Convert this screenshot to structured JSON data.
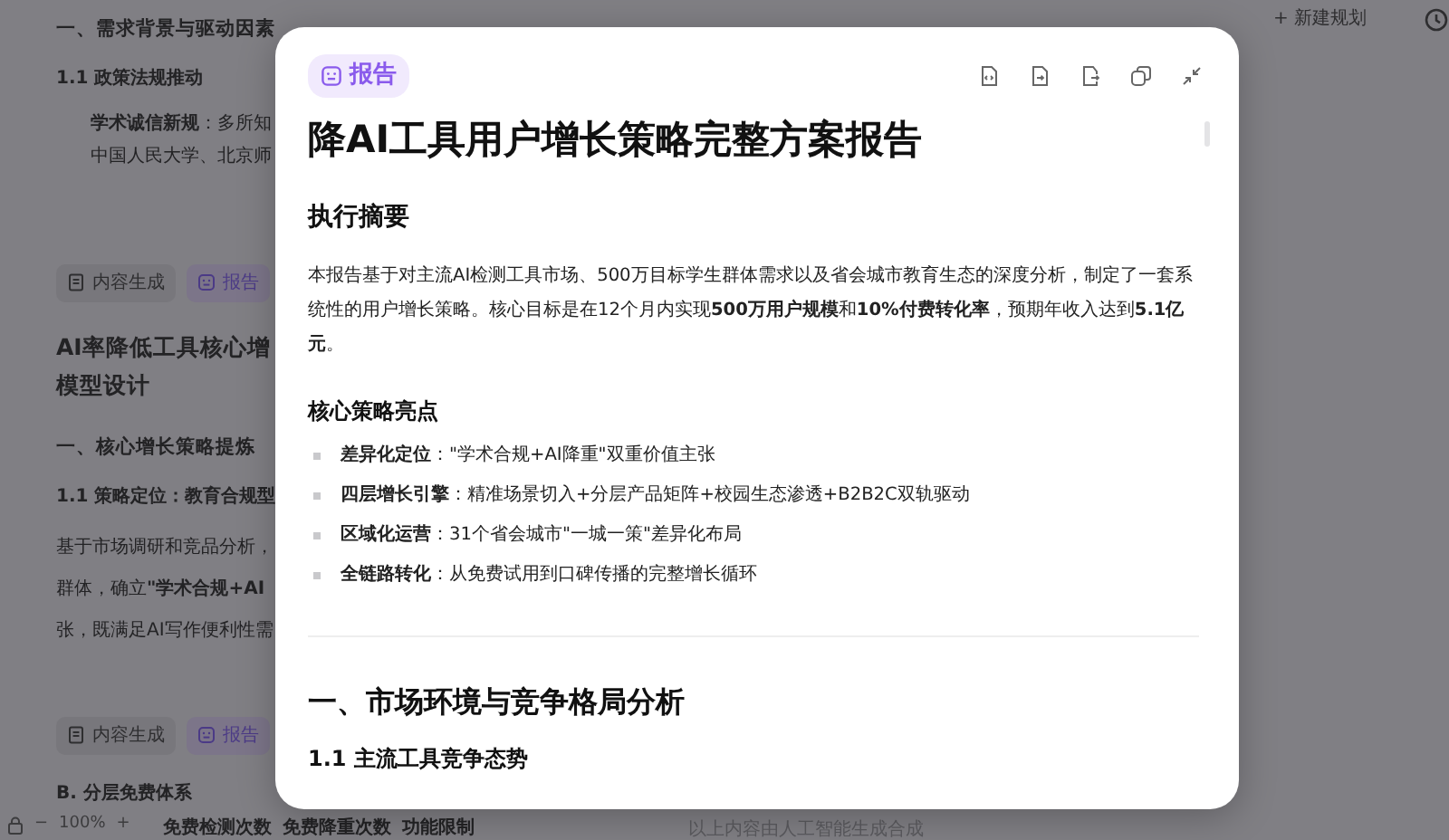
{
  "background_document": {
    "blocks": [
      {
        "kind": "heading",
        "text": "一、需求背景与驱动因素"
      },
      {
        "kind": "subheading",
        "text": "1.1 政策法规推动"
      },
      {
        "kind": "bullet",
        "lines": [
          "**学术诚信新规**：多所知",
          "中国人民大学、北京师"
        ]
      },
      {
        "kind": "tags",
        "tags": [
          {
            "label": "内容生成",
            "selected": false
          },
          {
            "label": "报告",
            "selected": true
          }
        ]
      },
      {
        "kind": "title",
        "lines": [
          "AI率降低工具核心增",
          "模型设计"
        ]
      },
      {
        "kind": "heading",
        "text": "一、核心增长策略提炼"
      },
      {
        "kind": "subheading",
        "text": "1.1 策略定位：教育合规型"
      },
      {
        "kind": "paragraph",
        "lines": [
          "基于市场调研和竞品分析，",
          "群体，确立**\"学术合规+AI**",
          "张，既满足AI写作便利性需"
        ]
      },
      {
        "kind": "tags",
        "tags": [
          {
            "label": "内容生成",
            "selected": false
          },
          {
            "label": "报告",
            "selected": true
          }
        ]
      },
      {
        "kind": "subheading",
        "text": "B. 分层免费体系"
      },
      {
        "kind": "table_header",
        "columns": [
          "免费检测次数",
          "免费降重次数",
          "功能限制"
        ]
      }
    ]
  },
  "zoom_control": {
    "value": "100%",
    "minus": "−",
    "plus": "+"
  },
  "toolbar": {
    "new_plan": "+ 新建规划"
  },
  "footer_note": "以上内容由人工智能生成合成",
  "report_modal": {
    "badge": "报告",
    "title": "降AI工具用户增长策略完整方案报告",
    "sections": [
      {
        "kind": "h2",
        "text": "执行摘要"
      },
      {
        "kind": "paragraph",
        "text": "本报告基于对主流AI检测工具市场、500万目标学生群体需求以及省会城市教育生态的深度分析，制定了一套系统性的用户增长策略。核心目标是在12个月内实现**500万用户规模**和**10%付费转化率**，预期年收入达到**5.1亿元**。"
      },
      {
        "kind": "h3",
        "text": "核心策略亮点"
      },
      {
        "kind": "bullets",
        "items": [
          "**差异化定位**：\"学术合规+AI降重\"双重价值主张",
          "**四层增长引擎**：精准场景切入+分层产品矩阵+校园生态渗透+B2B2C双轨驱动",
          "**区域化运营**：31个省会城市\"一城一策\"差异化布局",
          "**全链路转化**：从免费试用到口碑传播的完整增长循环"
        ]
      },
      {
        "kind": "divider"
      },
      {
        "kind": "h2",
        "text": "一、市场环境与竞争格局分析"
      },
      {
        "kind": "h3",
        "text": "1.1 主流工具竞争态势"
      }
    ]
  }
}
